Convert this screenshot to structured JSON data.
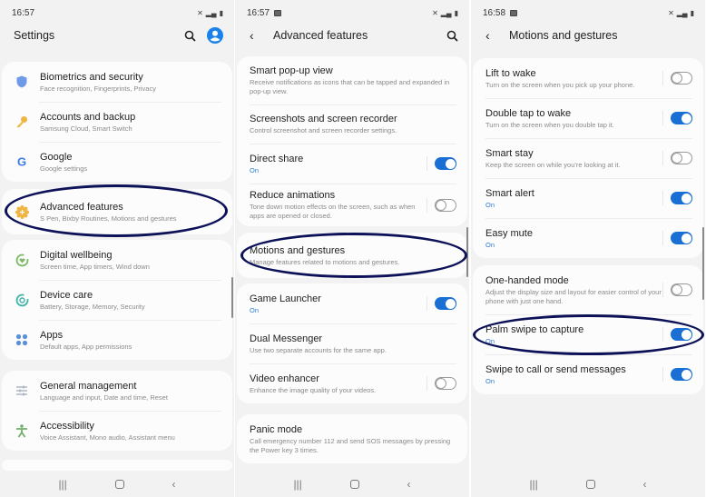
{
  "panels": {
    "settings": {
      "status": {
        "time": "16:57"
      },
      "title": "Settings",
      "groups": [
        [
          {
            "title": "Biometrics and security",
            "sub": "Face recognition, Fingerprints, Privacy",
            "icon": "shield-icon",
            "color": "#6f9ae8"
          },
          {
            "title": "Accounts and backup",
            "sub": "Samsung Cloud, Smart Switch",
            "icon": "key-icon",
            "color": "#f0b440"
          },
          {
            "title": "Google",
            "sub": "Google settings",
            "icon": "google-icon",
            "color": "#3b7be0"
          }
        ],
        [
          {
            "title": "Advanced features",
            "sub": "S Pen, Bixby Routines, Motions and gestures",
            "icon": "gear-plus-icon",
            "color": "#f0b440"
          }
        ],
        [
          {
            "title": "Digital wellbeing",
            "sub": "Screen time, App timers, Wind down",
            "icon": "wellbeing-icon",
            "color": "#7dbb63"
          },
          {
            "title": "Device care",
            "sub": "Battery, Storage, Memory, Security",
            "icon": "device-care-icon",
            "color": "#3fb5a8"
          },
          {
            "title": "Apps",
            "sub": "Default apps, App permissions",
            "icon": "apps-icon",
            "color": "#5b8fd8"
          }
        ],
        [
          {
            "title": "General management",
            "sub": "Language and input, Date and time, Reset",
            "icon": "sliders-icon",
            "color": "#9aa6b8"
          },
          {
            "title": "Accessibility",
            "sub": "Voice Assistant, Mono audio, Assistant menu",
            "icon": "accessibility-icon",
            "color": "#6fae6a"
          }
        ]
      ]
    },
    "advanced": {
      "status": {
        "time": "16:57"
      },
      "title": "Advanced features",
      "groups": [
        [
          {
            "title": "Smart pop-up view",
            "sub": "Receive notifications as icons that can be tapped and expanded in pop-up view."
          },
          {
            "title": "Screenshots and screen recorder",
            "sub": "Control screenshot and screen recorder settings."
          },
          {
            "title": "Direct share",
            "sub": "On",
            "toggle": true
          },
          {
            "title": "Reduce animations",
            "sub": "Tone down motion effects on the screen, such as when apps are opened or closed.",
            "toggle": false
          }
        ],
        [
          {
            "title": "Motions and gestures",
            "sub": "Manage features related to motions and gestures."
          }
        ],
        [
          {
            "title": "Game Launcher",
            "sub": "On",
            "toggle": true
          },
          {
            "title": "Dual Messenger",
            "sub": "Use two separate accounts for the same app."
          },
          {
            "title": "Video enhancer",
            "sub": "Enhance the image quality of your videos.",
            "toggle": false
          }
        ],
        [
          {
            "title": "Panic mode",
            "sub": "Call emergency number 112 and send SOS messages by pressing the Power key 3 times."
          }
        ]
      ]
    },
    "motions": {
      "status": {
        "time": "16:58"
      },
      "title": "Motions and gestures",
      "groups": [
        [
          {
            "title": "Lift to wake",
            "sub": "Turn on the screen when you pick up your phone.",
            "toggle": false
          },
          {
            "title": "Double tap to wake",
            "sub": "Turn on the screen when you double tap it.",
            "toggle": true
          },
          {
            "title": "Smart stay",
            "sub": "Keep the screen on while you're looking at it.",
            "toggle": false
          },
          {
            "title": "Smart alert",
            "sub": "On",
            "toggle": true
          },
          {
            "title": "Easy mute",
            "sub": "On",
            "toggle": true
          }
        ],
        [
          {
            "title": "One-handed mode",
            "sub": "Adjust the display size and layout for easier control of your phone with just one hand.",
            "toggle": false
          },
          {
            "title": "Palm swipe to capture",
            "sub": "On",
            "toggle": true
          },
          {
            "title": "Swipe to call or send messages",
            "sub": "On",
            "toggle": true
          }
        ]
      ]
    }
  },
  "status_icons": {
    "mute": "🔇",
    "signal": ".ıl",
    "battery": "▮"
  },
  "nav": {
    "recents": "|||",
    "back": "‹"
  },
  "accent": "#1a6fd4",
  "highlight_color": "#0d1258"
}
